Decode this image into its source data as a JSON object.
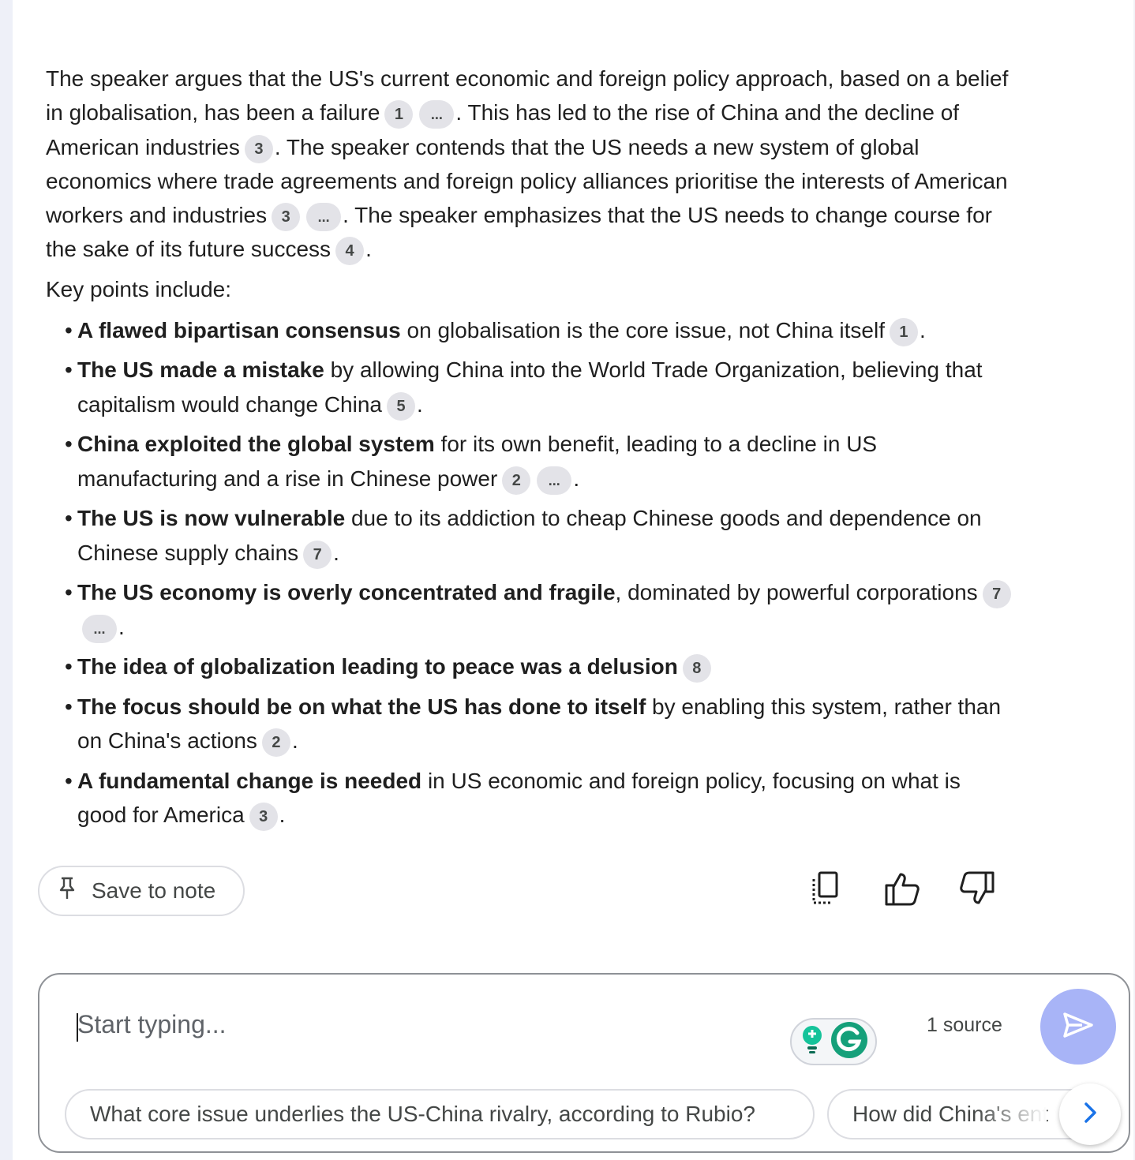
{
  "summary": {
    "p1": {
      "t1": "The speaker argues that the US's current economic and foreign policy approach, based on a belief in globalisation, has been a failure",
      "c1": "1",
      "c2": "...",
      "t2": ". This has led to the rise of China and the decline of American industries",
      "c3": "3",
      "t3": ". The speaker contends that the US needs a new system of global economics where trade agreements and foreign policy alliances prioritise the interests of American workers and industries",
      "c4": "3",
      "c5": "...",
      "t4": ". The speaker emphasizes that the US needs to change course for the sake of its future success",
      "c6": "4",
      "t5": "."
    },
    "key_points_label": "Key points include:",
    "points": [
      {
        "bold": "A flawed bipartisan consensus",
        "text": " on globalisation is the core issue, not China itself",
        "c1": "1",
        "end": "."
      },
      {
        "bold": "The US made a mistake",
        "text": " by allowing China into the World Trade Organization, believing that capitalism would change China",
        "c1": "5",
        "end": "."
      },
      {
        "bold": "China exploited the global system",
        "text": " for its own benefit, leading to a decline in US manufacturing and a rise in Chinese power",
        "c1": "2",
        "c2": "...",
        "end": "."
      },
      {
        "bold": "The US is now vulnerable",
        "text": " due to its addiction to cheap Chinese goods and dependence on Chinese supply chains",
        "c1": "7",
        "end": "."
      },
      {
        "bold": "The US economy is overly concentrated and fragile",
        "text": ", dominated by powerful corporations",
        "c1": "7",
        "c2": "...",
        "end": "."
      },
      {
        "bold": "The idea of globalization leading to peace was a delusion",
        "text": "",
        "c1": "8",
        "end": ""
      },
      {
        "bold": "The focus should be on what the US has done to itself",
        "text": " by enabling this system, rather than on China's actions",
        "c1": "2",
        "end": "."
      },
      {
        "bold": "A fundamental change is needed",
        "text": " in US economic and foreign policy, focusing on what is good for America",
        "c1": "3",
        "end": "."
      }
    ]
  },
  "actions": {
    "save_label": "Save to note",
    "icons": [
      "pin-icon",
      "copy-icon",
      "thumbs-up-icon",
      "thumbs-down-icon"
    ]
  },
  "composer": {
    "placeholder": "Start typing...",
    "source_count": "1 source",
    "icons": [
      "send-icon",
      "grammarly-icon",
      "chevron-right-icon"
    ],
    "suggestions": [
      "What core issue underlies the US-China rivalry, according to Rubio?",
      "How did China's ent"
    ]
  },
  "colors": {
    "send_button": "#a8b4f7",
    "citation_chip": "#e3e3e8",
    "accent_blue": "#1a73e8"
  }
}
